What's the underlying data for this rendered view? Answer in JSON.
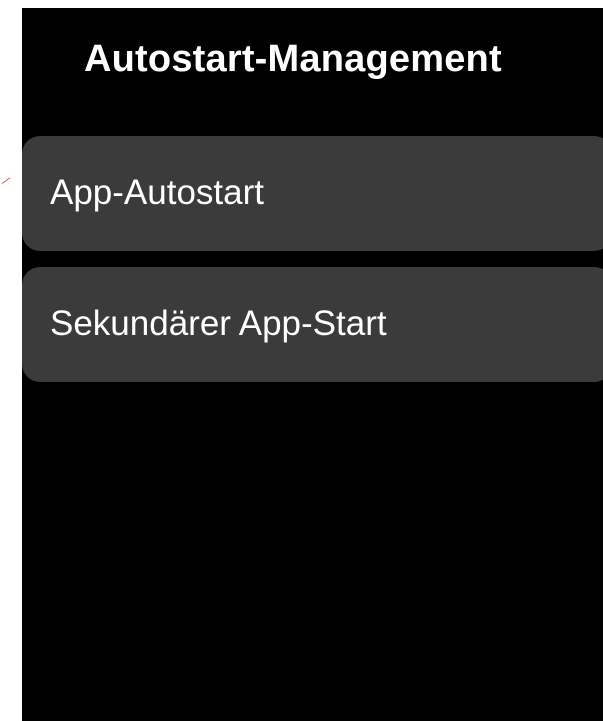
{
  "header": {
    "title": "Autostart-Management"
  },
  "menu": {
    "items": [
      {
        "label": "App-Autostart"
      },
      {
        "label": "Sekundärer App-Start"
      }
    ]
  },
  "colors": {
    "background": "#000000",
    "item_background": "#3b3b3b",
    "text": "#ffffff",
    "marker": "#d9534f"
  }
}
